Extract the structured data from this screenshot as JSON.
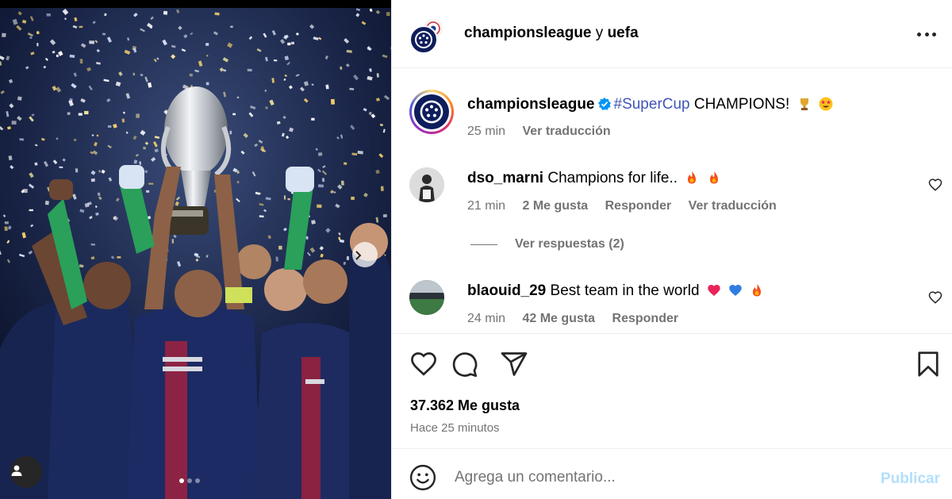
{
  "header": {
    "account": "championsleague",
    "conjunction": "y",
    "collaborator": "uefa"
  },
  "caption": {
    "username": "championsleague",
    "hashtag": "#SuperCup",
    "text": " CHAMPIONS!",
    "time": "25 min",
    "translate": "Ver traducción"
  },
  "comments": [
    {
      "username": "dso_marni",
      "text": "Champions for life..",
      "time": "21 min",
      "likes": "2 Me gusta",
      "reply": "Responder",
      "translate": "Ver traducción",
      "replies_link": "Ver respuestas (2)"
    },
    {
      "username": "blaouid_29",
      "text": "Best team in the world",
      "time": "24 min",
      "likes": "42 Me gusta",
      "reply": "Responder"
    }
  ],
  "post": {
    "likes": "37.362 Me gusta",
    "posted": "Hace 25 minutos"
  },
  "composer": {
    "placeholder": "Agrega un comentario...",
    "publish": "Publicar"
  },
  "icons": {
    "like": "heart-icon",
    "comment": "comment-icon",
    "share": "share-icon",
    "save": "bookmark-icon",
    "more": "more-icon"
  },
  "carousel": {
    "slides": 3,
    "current": 1
  },
  "colors": {
    "link": "#4056b8",
    "verified": "#0095f6",
    "publish_disabled": "#b2dffc",
    "muted": "#737373"
  }
}
